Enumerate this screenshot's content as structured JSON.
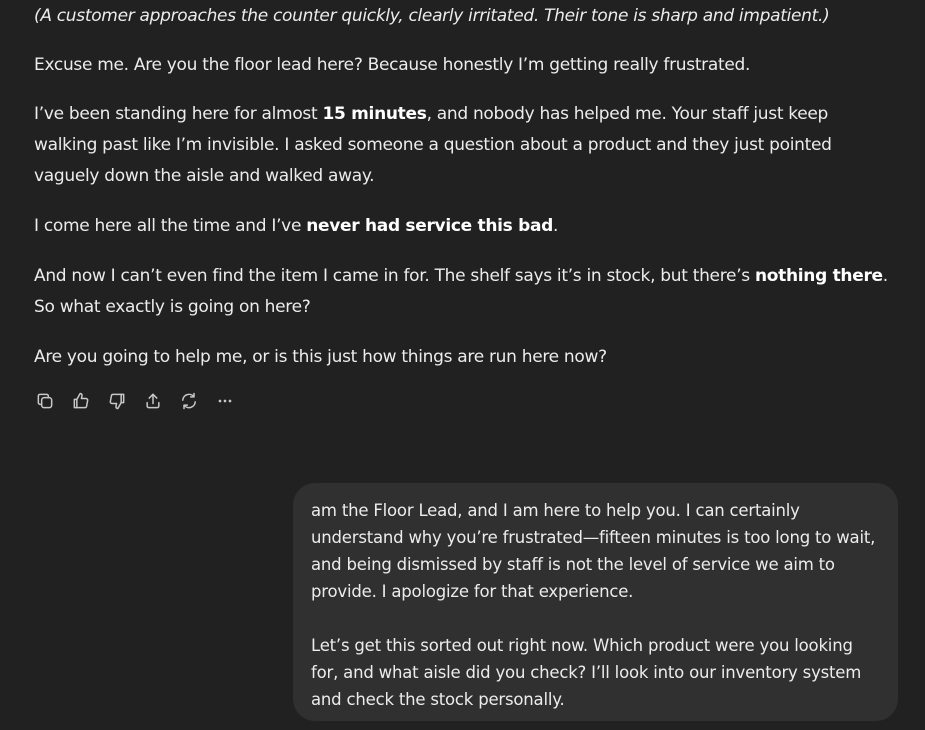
{
  "assistant_message": {
    "stage_direction": "(A customer approaches the counter quickly, clearly irritated. Their tone is sharp and impatient.)",
    "p1": "Excuse me. Are you the floor lead here? Because honestly I’m getting really frustrated.",
    "p2_before": "I’ve been standing here for almost ",
    "p2_bold": "15 minutes",
    "p2_after": ", and nobody has helped me. Your staff just keep walking past like I’m invisible. I asked someone a question about a product and they just pointed vaguely down the aisle and walked away.",
    "p3_before": "I come here all the time and I’ve ",
    "p3_bold": "never had service this bad",
    "p3_after": ".",
    "p4_before": "And now I can’t even find the item I came in for. The shelf says it’s in stock, but there’s ",
    "p4_bold": "nothing there",
    "p4_after": ". So what exactly is going on here?",
    "p5": "Are you going to help me, or is this just how things are run here now?"
  },
  "action_bar": {
    "icons": [
      "copy-icon",
      "thumbs-up-icon",
      "thumbs-down-icon",
      "share-icon",
      "regenerate-icon",
      "more-icon"
    ]
  },
  "user_message": {
    "p1": "am the Floor Lead, and I am here to help you. I can certainly understand why you’re frustrated—fifteen minutes is too long to wait, and being dismissed by staff is not the level of service we aim to provide. I apologize for that experience.",
    "p2": "Let’s get this sorted out right now. Which product were you looking for, and what aisle did you check? I’ll look into our inventory system and check the stock personally."
  },
  "colors": {
    "background": "#212121",
    "user_bubble": "#303030",
    "text": "#ececec"
  }
}
